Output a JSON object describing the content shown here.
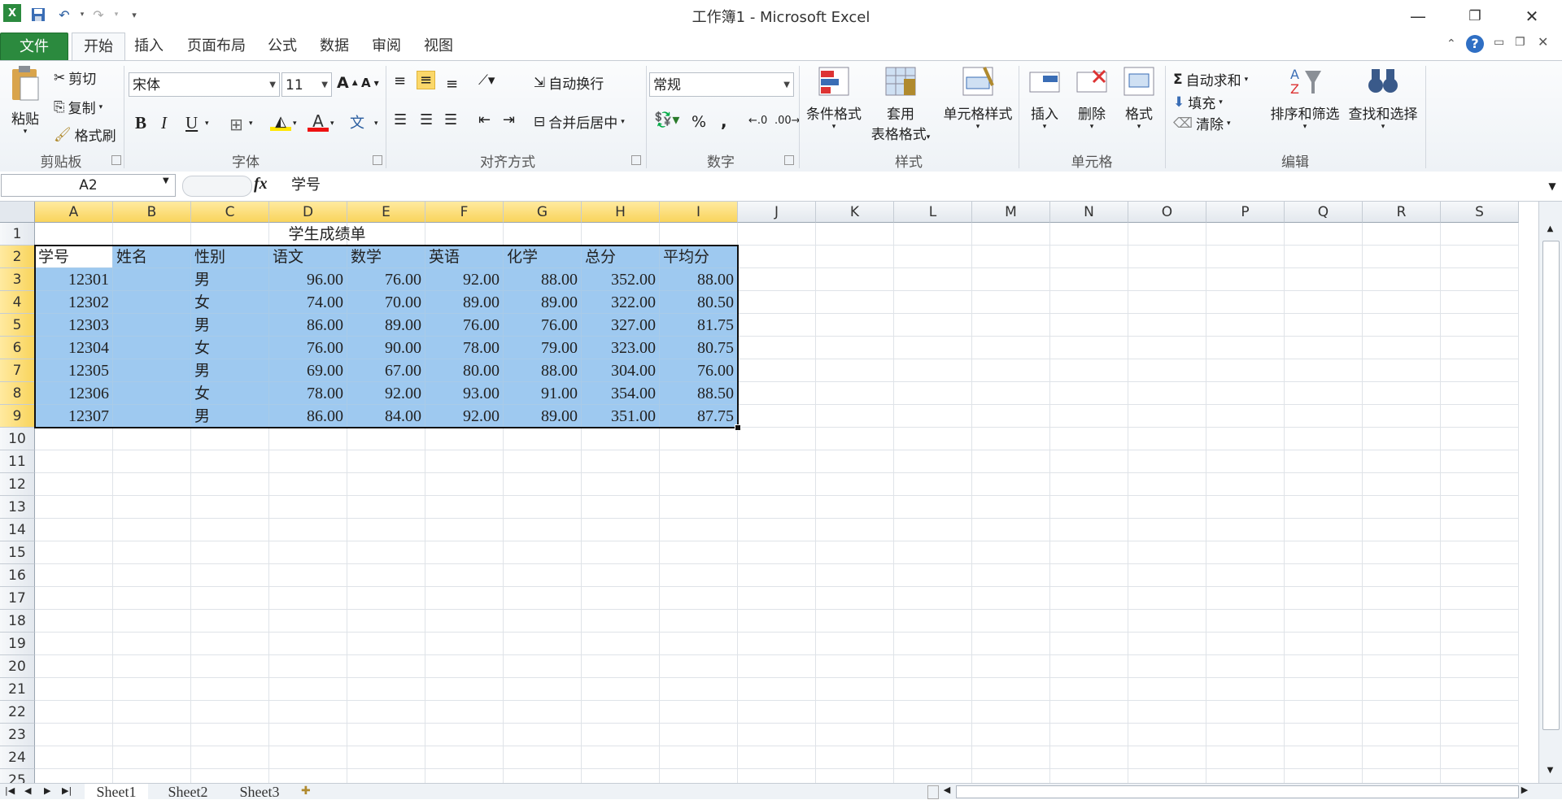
{
  "window": {
    "title": "工作簿1 - Microsoft Excel"
  },
  "tabs": [
    {
      "label": "文件"
    },
    {
      "label": "开始"
    },
    {
      "label": "插入"
    },
    {
      "label": "页面布局"
    },
    {
      "label": "公式"
    },
    {
      "label": "数据"
    },
    {
      "label": "审阅"
    },
    {
      "label": "视图"
    }
  ],
  "ribbon": {
    "clipboard": {
      "paste": "粘贴",
      "cut": "剪切",
      "copy": "复制",
      "format_painter": "格式刷",
      "label": "剪贴板"
    },
    "font": {
      "name": "宋体",
      "size": "11",
      "label": "字体",
      "bold": "B",
      "italic": "I",
      "underline": "U"
    },
    "alignment": {
      "wrap": "自动换行",
      "merge": "合并后居中",
      "label": "对齐方式"
    },
    "number": {
      "format": "常规",
      "label": "数字",
      "percent": "%",
      "comma": ","
    },
    "styles": {
      "conditional": "条件格式",
      "table1": "套用",
      "table2": "表格格式",
      "cell_styles": "单元格样式",
      "label": "样式"
    },
    "cells": {
      "insert": "插入",
      "delete": "删除",
      "format": "格式",
      "label": "单元格"
    },
    "editing": {
      "autosum": "自动求和",
      "fill": "填充",
      "clear": "清除",
      "sort": "排序和筛选",
      "find": "查找和选择",
      "label": "编辑"
    }
  },
  "formula": {
    "namebox": "A2",
    "fx": "fx",
    "content": "学号"
  },
  "columns": [
    "A",
    "B",
    "C",
    "D",
    "E",
    "F",
    "G",
    "H",
    "I",
    "J",
    "K",
    "L",
    "M",
    "N",
    "O",
    "P",
    "Q",
    "R",
    "S"
  ],
  "rows": [
    "1",
    "2",
    "3",
    "4",
    "5",
    "6",
    "7",
    "8",
    "9",
    "10",
    "11",
    "12",
    "13",
    "14",
    "15",
    "16",
    "17",
    "18",
    "19",
    "20",
    "21",
    "22",
    "23",
    "24",
    "25"
  ],
  "sheet": {
    "title": "学生成绩单",
    "headers": [
      "学号",
      "姓名",
      "性别",
      "语文",
      "数学",
      "英语",
      "化学",
      "总分",
      "平均分"
    ],
    "data": [
      [
        "12301",
        "",
        "男",
        "96.00",
        "76.00",
        "92.00",
        "88.00",
        "352.00",
        "88.00"
      ],
      [
        "12302",
        "",
        "女",
        "74.00",
        "70.00",
        "89.00",
        "89.00",
        "322.00",
        "80.50"
      ],
      [
        "12303",
        "",
        "男",
        "86.00",
        "89.00",
        "76.00",
        "76.00",
        "327.00",
        "81.75"
      ],
      [
        "12304",
        "",
        "女",
        "76.00",
        "90.00",
        "78.00",
        "79.00",
        "323.00",
        "80.75"
      ],
      [
        "12305",
        "",
        "男",
        "69.00",
        "67.00",
        "80.00",
        "88.00",
        "304.00",
        "76.00"
      ],
      [
        "12306",
        "",
        "女",
        "78.00",
        "92.00",
        "93.00",
        "91.00",
        "354.00",
        "88.50"
      ],
      [
        "12307",
        "",
        "男",
        "86.00",
        "84.00",
        "92.00",
        "89.00",
        "351.00",
        "87.75"
      ]
    ]
  },
  "sheets": [
    "Sheet1",
    "Sheet2",
    "Sheet3"
  ],
  "colors": {
    "selection": "#9ec9f0",
    "header_selected": "#f9d45c",
    "file_tab": "#2b8a3e"
  }
}
